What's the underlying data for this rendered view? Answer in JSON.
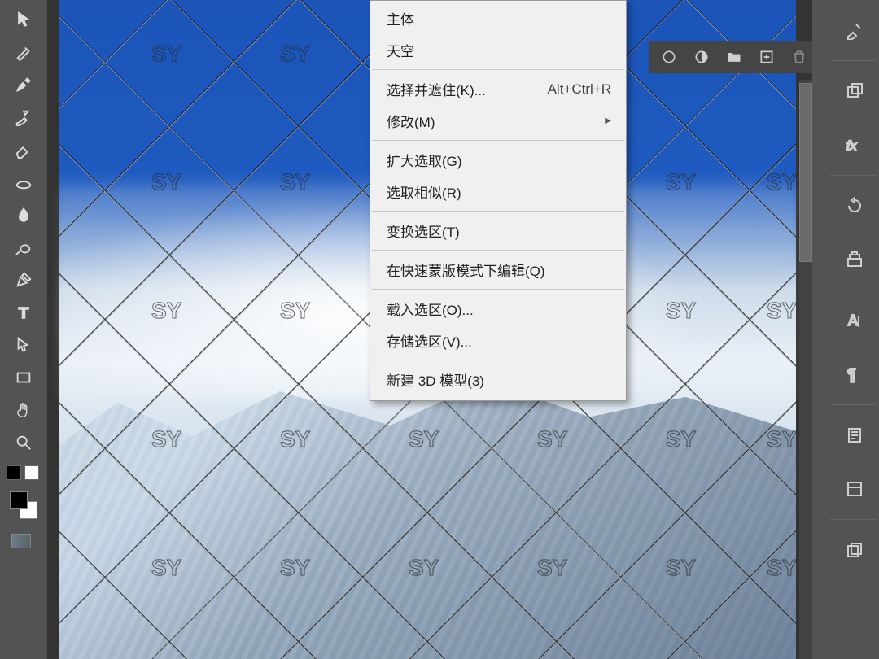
{
  "menu": {
    "sky": "天空",
    "select_and_mask": {
      "label": "选择并遮住(K)...",
      "shortcut": "Alt+Ctrl+R"
    },
    "modify": "修改(M)",
    "grow": "扩大选取(G)",
    "similar": "选取相似(R)",
    "transform": "变换选区(T)",
    "quickmask": "在快速蒙版模式下编辑(Q)",
    "load": "载入选区(O)...",
    "save": "存储选区(V)...",
    "new3d": "新建 3D 模型(3)",
    "subject": "主体"
  },
  "watermark_text": "SY",
  "tools_left": [
    "move-tool",
    "marquee-tool",
    "lasso-tool",
    "healing-brush-tool",
    "brush-tool",
    "clone-stamp-tool",
    "eraser-tool",
    "gradient-tool",
    "blur-tool",
    "dodge-tool",
    "pen-tool",
    "type-tool",
    "path-selection-tool",
    "rectangle-tool",
    "hand-tool",
    "zoom-tool"
  ],
  "top_icons": [
    "circle-icon",
    "half-circle-icon",
    "folder-icon",
    "new-layer-icon",
    "trash-icon"
  ],
  "right_tools": [
    "brush-panel-icon",
    "fx-icon",
    "history-icon",
    "actions-icon",
    "character-icon",
    "paragraph-icon",
    "notes-icon",
    "properties-icon",
    "files-icon"
  ]
}
